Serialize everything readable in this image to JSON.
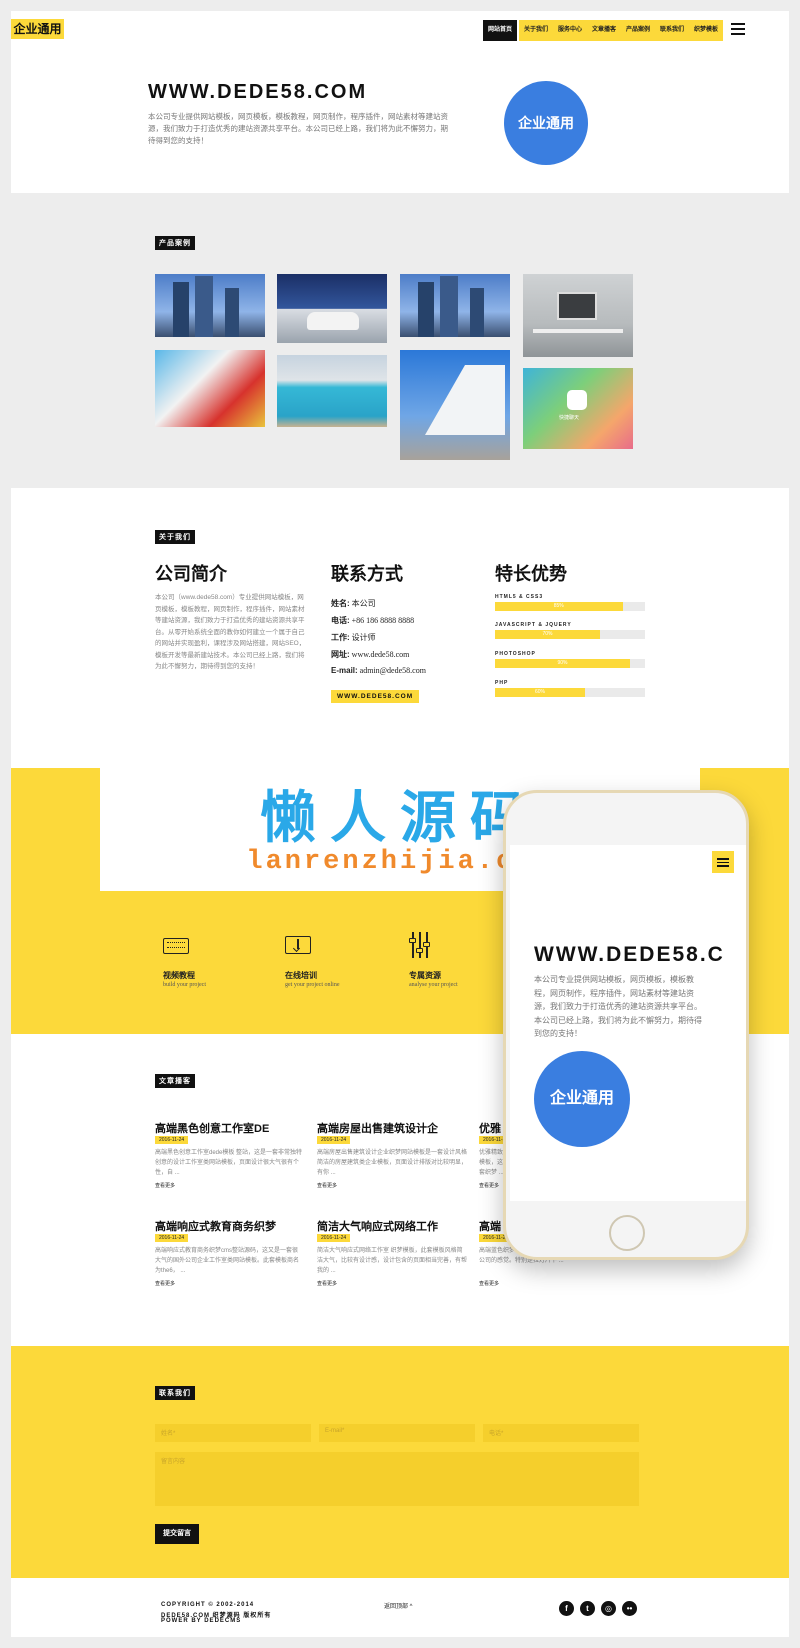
{
  "header": {
    "logo": "企业通用",
    "nav": [
      "网站首页",
      "关于我们",
      "服务中心",
      "文章播客",
      "产品案例",
      "联系我们",
      "织梦模板"
    ],
    "active_nav": "网站首页"
  },
  "hero": {
    "title": "WWW.DEDE58.COM",
    "description": "本公司专业提供网站模板，网页模板，模板教程，网页制作，程序插件，网站素材等建站资源，我们致力于打造优秀的建站资源共享平台。本公司已经上路，我们将为此不懈努力，期待得到您的支持！",
    "circle_label": "企业通用"
  },
  "products": {
    "tag": "产品案例",
    "images": [
      "city-towers-photo",
      "white-sportscar-photo",
      "city-towers-photo-2",
      "desk-workspace-photo",
      "colorful-houses-photo",
      "infinity-pool-photo",
      "modern-building-photo",
      "app-icon-photo"
    ],
    "app_caption": "快捷聊天"
  },
  "about": {
    "tag": "关于我们",
    "intro_title": "公司简介",
    "intro_text": "本公司（www.dede58.com）专业提供网站模板，网页模板，模板教程，网页制作，程序插件，网站素材等建站资源，我们致力于打造优秀的建站资源共享平台。从零开始系统全面的教你如何建立一个属于自己的网站并实现盈利，课程涉及网站搭建，网站SEO，模板开发等最新建站技术。本公司已经上路，我们将为此不懈努力，期待得到您的支持！",
    "contact_title": "联系方式",
    "contact": [
      {
        "label": "姓名:",
        "value": "本公司"
      },
      {
        "label": "电话:",
        "value": "+86 186 8888 8888"
      },
      {
        "label": "工作:",
        "value": "设计师"
      },
      {
        "label": "网址:",
        "value": "www.dede58.com"
      },
      {
        "label": "E-mail:",
        "value": "admin@dede58.com"
      }
    ],
    "contact_button": "WWW.DEDE58.COM",
    "skills_title": "特长优势",
    "skills": [
      {
        "name": "HTML5 & CSS3",
        "percent": 85,
        "label": "85%"
      },
      {
        "name": "JAVASCRIPT & JQUERY",
        "percent": 70,
        "label": "70%"
      },
      {
        "name": "PHOTOSHOP",
        "percent": 90,
        "label": "90%"
      },
      {
        "name": "PHP",
        "percent": 60,
        "label": "60%"
      }
    ]
  },
  "watermark": {
    "title": "懒人源码",
    "url": "lanrenzhijia.com"
  },
  "services": [
    {
      "title": "视频教程",
      "sub": "build your project",
      "icon": "keyboard-icon"
    },
    {
      "title": "在线培训",
      "sub": "get your project online",
      "icon": "monitor-download-icon"
    },
    {
      "title": "专属资源",
      "sub": "analyse your project",
      "icon": "sliders-icon"
    }
  ],
  "phone": {
    "title": "WWW.DEDE58.C",
    "description": "本公司专业提供网站模板，网页模板，模板教程，网页制作，程序插件，网站素材等建站资源，我们致力于打造优秀的建站资源共享平台。本公司已经上路，我们将为此不懈努力，期待得到您的支持！",
    "circle_label": "企业通用"
  },
  "blog": {
    "tag": "文章播客",
    "posts": [
      {
        "title": "高端黑色创意工作室DE",
        "date": "2016-11-24",
        "excerpt": "高端黑色创意工作室dede模板 整站，这是一套非常独特创意的设计工作室类网站模板，页面设计很大气很有个性，自 ...",
        "more": "查看更多"
      },
      {
        "title": "高端房屋出售建筑设计企",
        "date": "2016-11-24",
        "excerpt": "高端房屋出售建筑设计企业织梦网站模板是一套设计风格简洁的房屋建筑类企业模板，页面设计排版对比较明显，有你 ...",
        "more": "查看更多"
      },
      {
        "title": "优雅",
        "date": "2016-11-24",
        "excerpt": "优雅精致织梦模板，这是一套织梦 ...",
        "more": "查看更多"
      },
      {
        "title": "高端响应式教育商务织梦",
        "date": "2016-11-24",
        "excerpt": "高端响应式教育商务织梦cms整站源码，这又是一套很大气的国外公司企业工作室类网站模板。此套模板商名为the6， ...",
        "more": "查看更多"
      },
      {
        "title": "简洁大气响应式网络工作",
        "date": "2016-11-24",
        "excerpt": "简洁大气响应式网络工作室 织梦模板，此套模板风格简洁大气，比较有设计感，设计包含的页面相当完善，有帮我的 ...",
        "more": "查看更多"
      },
      {
        "title": "高端",
        "date": "2016-11-24",
        "excerpt": "高端蓝色织梦模板，页面设计和排版，这就会有很好的视觉公司的感觉。特别是拉灯片下 ...",
        "more": "查看更多"
      }
    ]
  },
  "contact_form": {
    "tag": "联系我们",
    "name_placeholder": "姓名*",
    "email_placeholder": "E-mail*",
    "phone_placeholder": "电话*",
    "message_placeholder": "留言内容",
    "submit": "提交留言"
  },
  "footer": {
    "copyright_1": "COPYRIGHT © 2002-2014",
    "copyright_2": "DEDE58.COM 织梦源码 版权所有",
    "copyright_3": "POWER BY DEDECMS",
    "back_top": "返回顶部 ^",
    "socials": [
      "facebook-icon",
      "twitter-icon",
      "dribbble-icon",
      "flickr-icon"
    ]
  },
  "colors": {
    "accent": "#fcd93a",
    "circle": "#3a7ee0",
    "watermark_title": "#2aa8e8",
    "watermark_url": "#f08a2c"
  }
}
